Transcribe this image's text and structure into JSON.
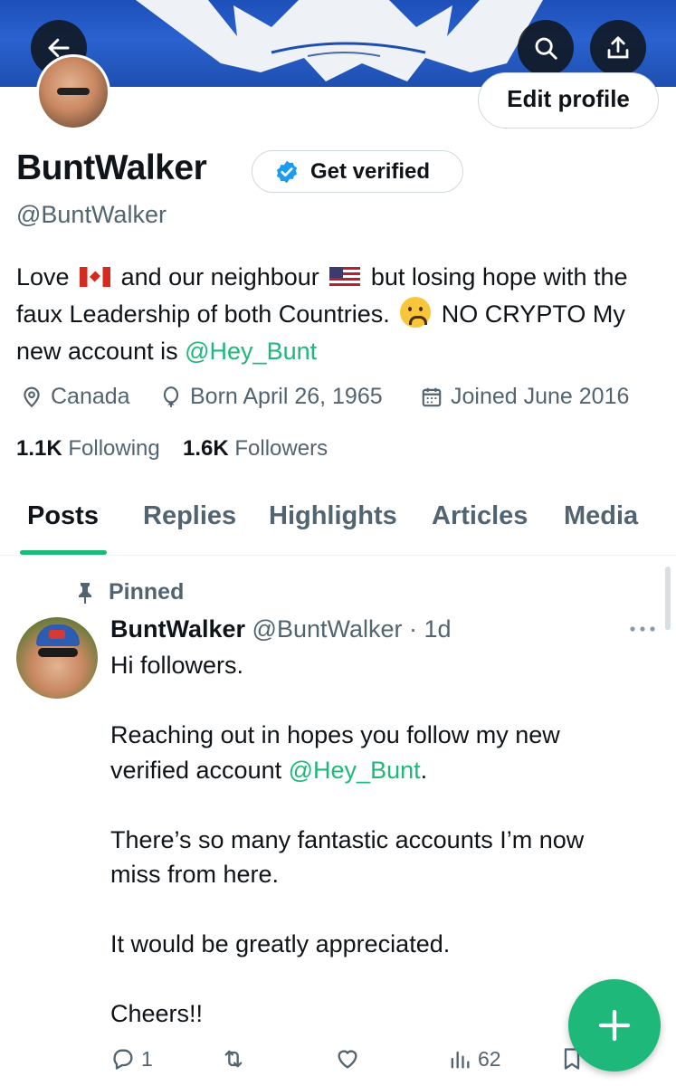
{
  "header": {
    "back_icon": "arrow-left-icon",
    "search_icon": "search-icon",
    "share_icon": "share-icon",
    "edit_profile_label": "Edit profile"
  },
  "profile": {
    "name": "BuntWalker",
    "get_verified_label": "Get verified",
    "handle": "@BuntWalker",
    "bio": {
      "part1": "Love",
      "part2": "and our neighbour",
      "part3": "but losing hope with the faux Leadership of both Countries.",
      "part4": "NO CRYPTO My new account is",
      "link": "@Hey_Bunt"
    },
    "location": "Canada",
    "born": "Born April 26, 1965",
    "joined": "Joined June 2016",
    "following_count": "1.1K",
    "following_label": "Following",
    "followers_count": "1.6K",
    "followers_label": "Followers"
  },
  "tabs": [
    "Posts",
    "Replies",
    "Highlights",
    "Articles",
    "Media"
  ],
  "post": {
    "pinned_label": "Pinned",
    "author_name": "BuntWalker",
    "author_handle": "@BuntWalker",
    "time": "1d",
    "lines": {
      "l1": "Hi followers.",
      "l2a": "Reaching out in hopes you follow my new",
      "l2b": "verified account",
      "l2link": "@Hey_Bunt",
      "l2end": ".",
      "l3a": "There’s so many fantastic accounts I’m now",
      "l3b": "miss from here.",
      "l4": "It would be greatly appreciated.",
      "l5": "Cheers!!"
    },
    "reply_count": "1",
    "view_count": "62"
  },
  "colors": {
    "accent": "#1db87a",
    "text_secondary": "#536471",
    "verified_blue": "#1d9bf0"
  }
}
